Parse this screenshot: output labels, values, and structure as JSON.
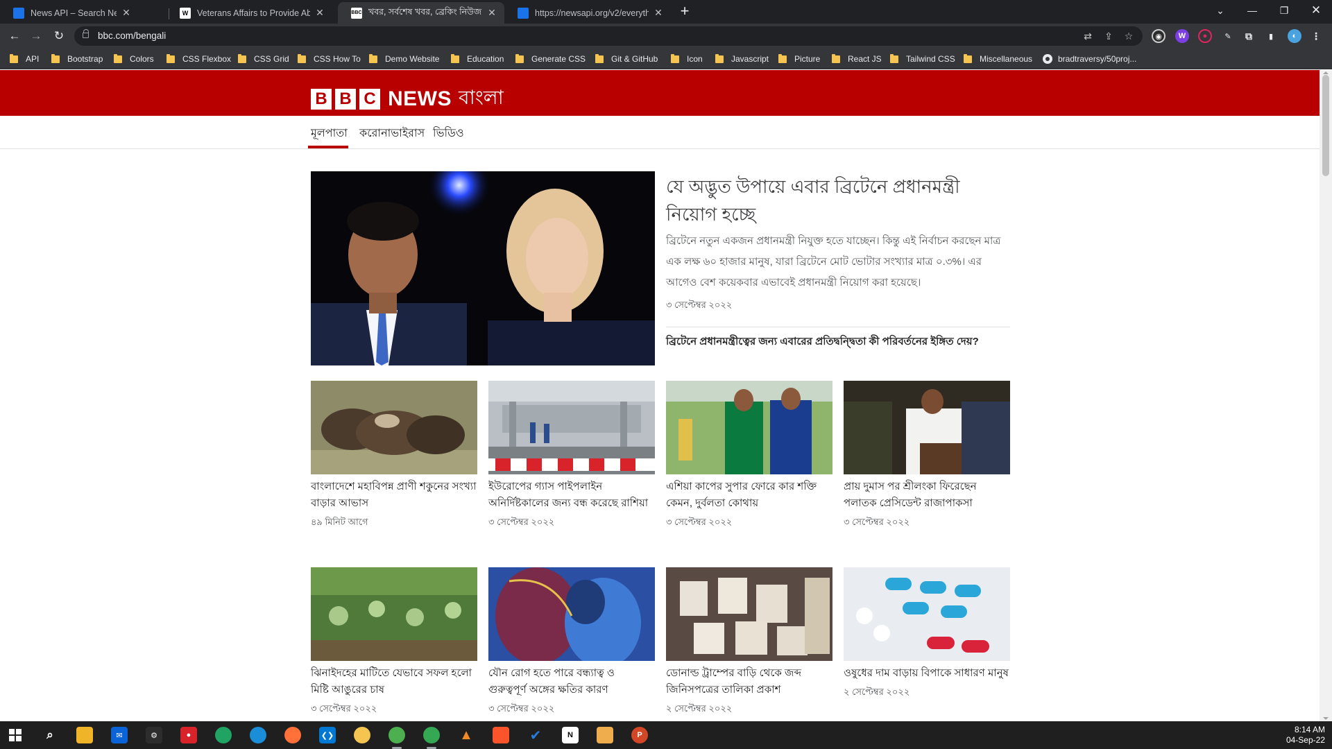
{
  "browser": {
    "tabs": [
      {
        "title": "News API – Search News and Blo",
        "favicon": "doc-icon",
        "color": "#1a73e8"
      },
      {
        "title": "Veterans Affairs to Provide Abort",
        "favicon": "wsj-icon",
        "color": "#ffffff"
      },
      {
        "title": "খবর, সর্বশেষ খবর, ব্রেকিং নিউজ |",
        "favicon": "bbc-icon",
        "color": "#ffffff"
      },
      {
        "title": "https://newsapi.org/v2/everythin",
        "favicon": "doc-icon",
        "color": "#1a73e8"
      }
    ],
    "url": "bbc.com/bengali",
    "bookmarks": [
      "API",
      "Bootstrap",
      "Colors",
      "CSS Flexbox",
      "CSS Grid",
      "CSS How To",
      "Demo Website",
      "Education",
      "Generate CSS",
      "Git & GitHub",
      "Icon",
      "Javascript",
      "Picture",
      "React JS",
      "Tailwind CSS",
      "Miscellaneous",
      "bradtraversy/50proj..."
    ]
  },
  "bbc": {
    "logo_letters": [
      "B",
      "B",
      "C"
    ],
    "news": "NEWS",
    "bangla": "বাংলা",
    "brand_color": "#b80000",
    "nav": [
      "মূলপাতা",
      "করোনাভাইরাস",
      "ভিডিও"
    ],
    "hero": {
      "title": "যে অদ্ভুত উপায়ে এবার ব্রিটেনে প্রধানমন্ত্রী নিয়োগ হচ্ছে",
      "summary": "ব্রিটেনে নতুন একজন প্রধানমন্ত্রী নিযুক্ত হতে যাচ্ছেন। কিন্তু এই নির্বাচন করছেন মাত্র এক লক্ষ ৬০ হাজার মানুষ, যারা ব্রিটেনে মোট ভোটার সংখ্যার মাত্র ০.৩%। এর আগেও বেশ কয়েকবার এভাবেই প্রধানমন্ত্রী নিয়োগ করা হয়েছে।",
      "date": "৩ সেপ্টেম্বর ২০২২",
      "related": "ব্রিটেনে প্রধানমন্ত্রীত্বের জন্য এবারের প্রতিদ্বন্দ্বিতা কী পরিবর্তনের ইঙ্গিত দেয়?"
    },
    "cards": [
      {
        "title": "বাংলাদেশে মহাবিপন্ন প্রাণী শকুনের সংখ্যা বাড়ার আভাস",
        "date": "৪৯ মিনিট আগে"
      },
      {
        "title": "ইউরোপের গ্যাস পাইপলাইন অনির্দিষ্টকালের জন্য বন্ধ করেছে রাশিয়া",
        "date": "৩ সেপ্টেম্বর ২০২২"
      },
      {
        "title": "এশিয়া কাপের সুপার ফোরে কার শক্তি কেমন, দুর্বলতা কোথায়",
        "date": "৩ সেপ্টেম্বর ২০২২"
      },
      {
        "title": "প্রায় দুমাস পর শ্রীলংকা ফিরেছেন পলাতক প্রেসিডেন্ট রাজাপাকসা",
        "date": "৩ সেপ্টেম্বর ২০২২"
      },
      {
        "title": "ঝিনাইদহের মাটিতে যেভাবে সফল হলো মিষ্টি আঙুরের চাষ",
        "date": "৩ সেপ্টেম্বর ২০২২"
      },
      {
        "title": "যৌন রোগ হতে পারে বন্ধ্যাত্ব ও গুরুত্বপূর্ণ অঙ্গের ক্ষতির কারণ",
        "date": "৩ সেপ্টেম্বর ২০২২"
      },
      {
        "title": "ডোনাল্ড ট্রাম্পের বাড়ি থেকে জব্দ জিনিসপত্রের তালিকা প্রকাশ",
        "date": "২ সেপ্টেম্বর ২০২২"
      },
      {
        "title": "ওষুধের দাম বাড়ায় বিপাকে সাধারণ মানুষ",
        "date": "২ সেপ্টেম্বর ২০২২"
      }
    ]
  },
  "taskbar": {
    "time": "8:14 AM",
    "date": "04-Sep-22"
  }
}
